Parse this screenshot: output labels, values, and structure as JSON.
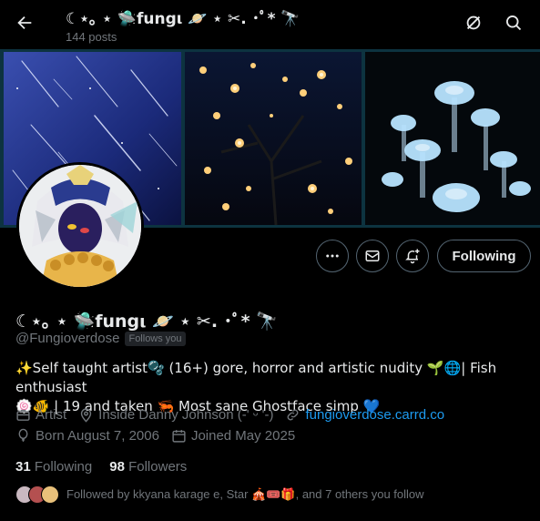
{
  "header": {
    "title": "☾⋆｡    ⋆ 🛸fungι 🪐 ⋆ ✂︎. ･ﾟ* 🔭",
    "posts_count": "144 posts",
    "back_icon": "arrow-left-icon",
    "grok_icon": "slash-circle-icon",
    "search_icon": "search-icon"
  },
  "banner": {
    "tiles": [
      "starry-sky",
      "fairy-lights-tree",
      "glowing-mushrooms"
    ],
    "accent": "#0d3340"
  },
  "actions": {
    "more_icon": "more-dots-icon",
    "message_icon": "envelope-icon",
    "notify_icon": "bell-plus-icon",
    "follow_label": "Following"
  },
  "profile": {
    "display_name": "☾⋆｡    ⋆ 🛸fungι 🪐 ⋆ ✂︎. ･ﾟ* 🔭",
    "handle": "@Fungioverdose",
    "follows_you": "Follows you",
    "bio_line1": "✨Self taught artist🫧 (16+) gore, horror and artistic nudity 🌱🌐| Fish enthusiast",
    "bio_line2": "🍥🐠 | 19 and taken 🦐 Most sane Ghostface simp 💙",
    "category": "Artist",
    "location": "Inside Danny Johnson (-' ᵕ '-)",
    "website": "fungioverdose.carrd.co",
    "born": "Born August 7, 2006",
    "joined": "Joined May 2025"
  },
  "stats": {
    "following_count": "31",
    "following_label": "Following",
    "followers_count": "98",
    "followers_label": "Followers"
  },
  "followed_by": {
    "text": "Followed by kkyana karage e, Star 🎪🎟️🎁, and 7 others you follow"
  },
  "colors": {
    "background": "#000000",
    "text": "#e7e9ea",
    "muted": "#71767b",
    "link": "#1d9bf0",
    "border": "#536471"
  }
}
